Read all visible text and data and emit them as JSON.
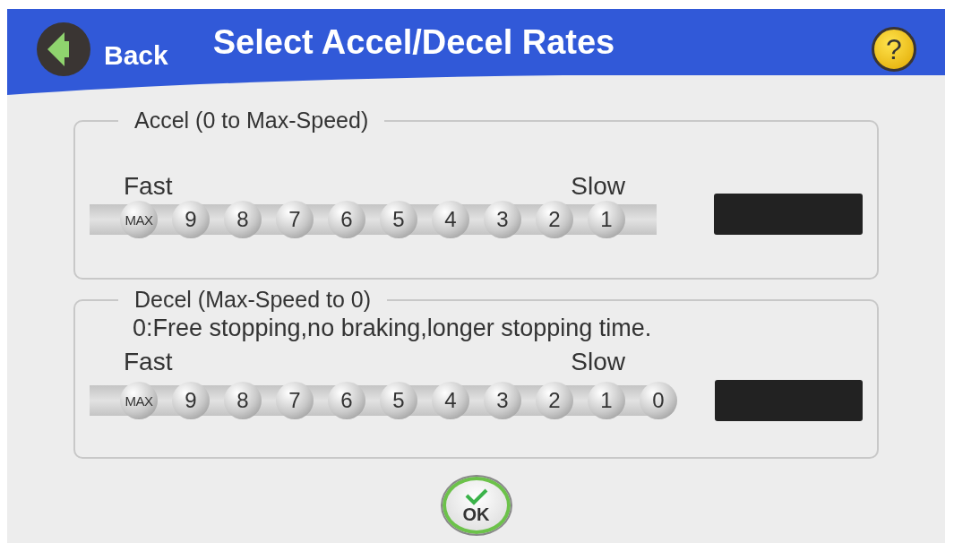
{
  "header": {
    "back_label": "Back",
    "title": "Select Accel/Decel Rates",
    "help_label": "?"
  },
  "sections": [
    {
      "title": "Accel (0 to Max-Speed)",
      "fast_label": "Fast",
      "slow_label": "Slow",
      "rates": [
        "MAX",
        "9",
        "8",
        "7",
        "6",
        "5",
        "4",
        "3",
        "2",
        "1"
      ]
    },
    {
      "title": "Decel (Max-Speed to 0)",
      "note": "0:Free stopping,no braking,longer stopping time.",
      "fast_label": "Fast",
      "slow_label": "Slow",
      "rates": [
        "MAX",
        "9",
        "8",
        "7",
        "6",
        "5",
        "4",
        "3",
        "2",
        "1",
        "0"
      ]
    }
  ],
  "ok_label": "OK"
}
